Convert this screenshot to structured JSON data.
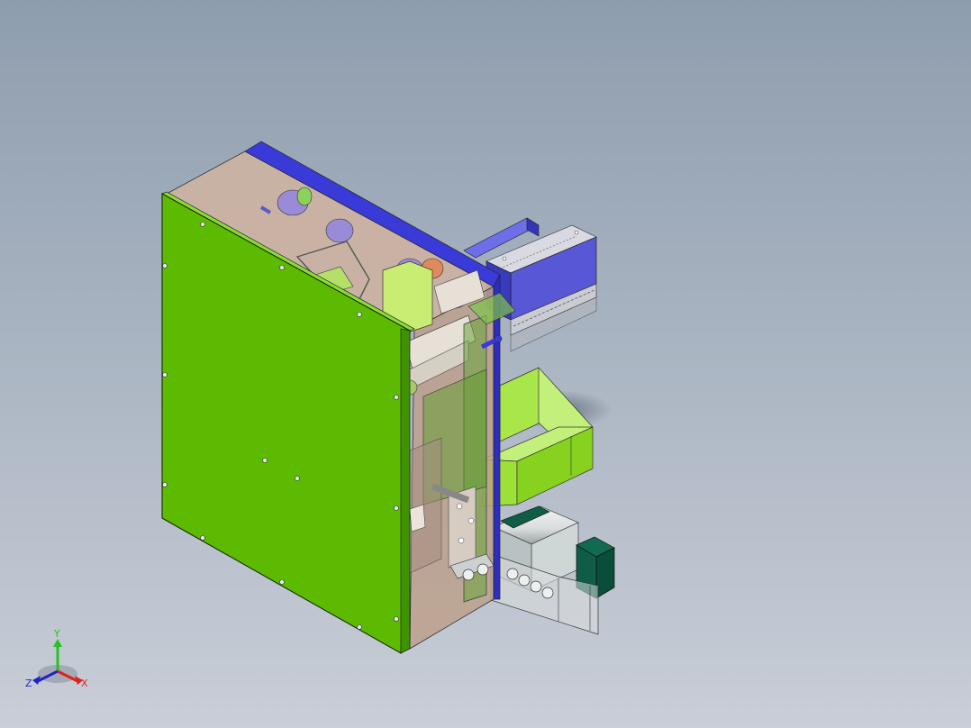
{
  "viewport": {
    "background_top": "#8e9dae",
    "background_bottom": "#c9ced7"
  },
  "model": {
    "plate_color": "#5cbb00",
    "housing_color": "#c8a995",
    "rail_color": "#3a3adf",
    "block_color": "#a4e83a",
    "cylinder_color": "#0b4d3b"
  },
  "triad": {
    "x_label": "X",
    "y_label": "Y",
    "z_label": "Z",
    "x_color": "#e0201c",
    "y_color": "#22c322",
    "z_color": "#2020d0"
  }
}
